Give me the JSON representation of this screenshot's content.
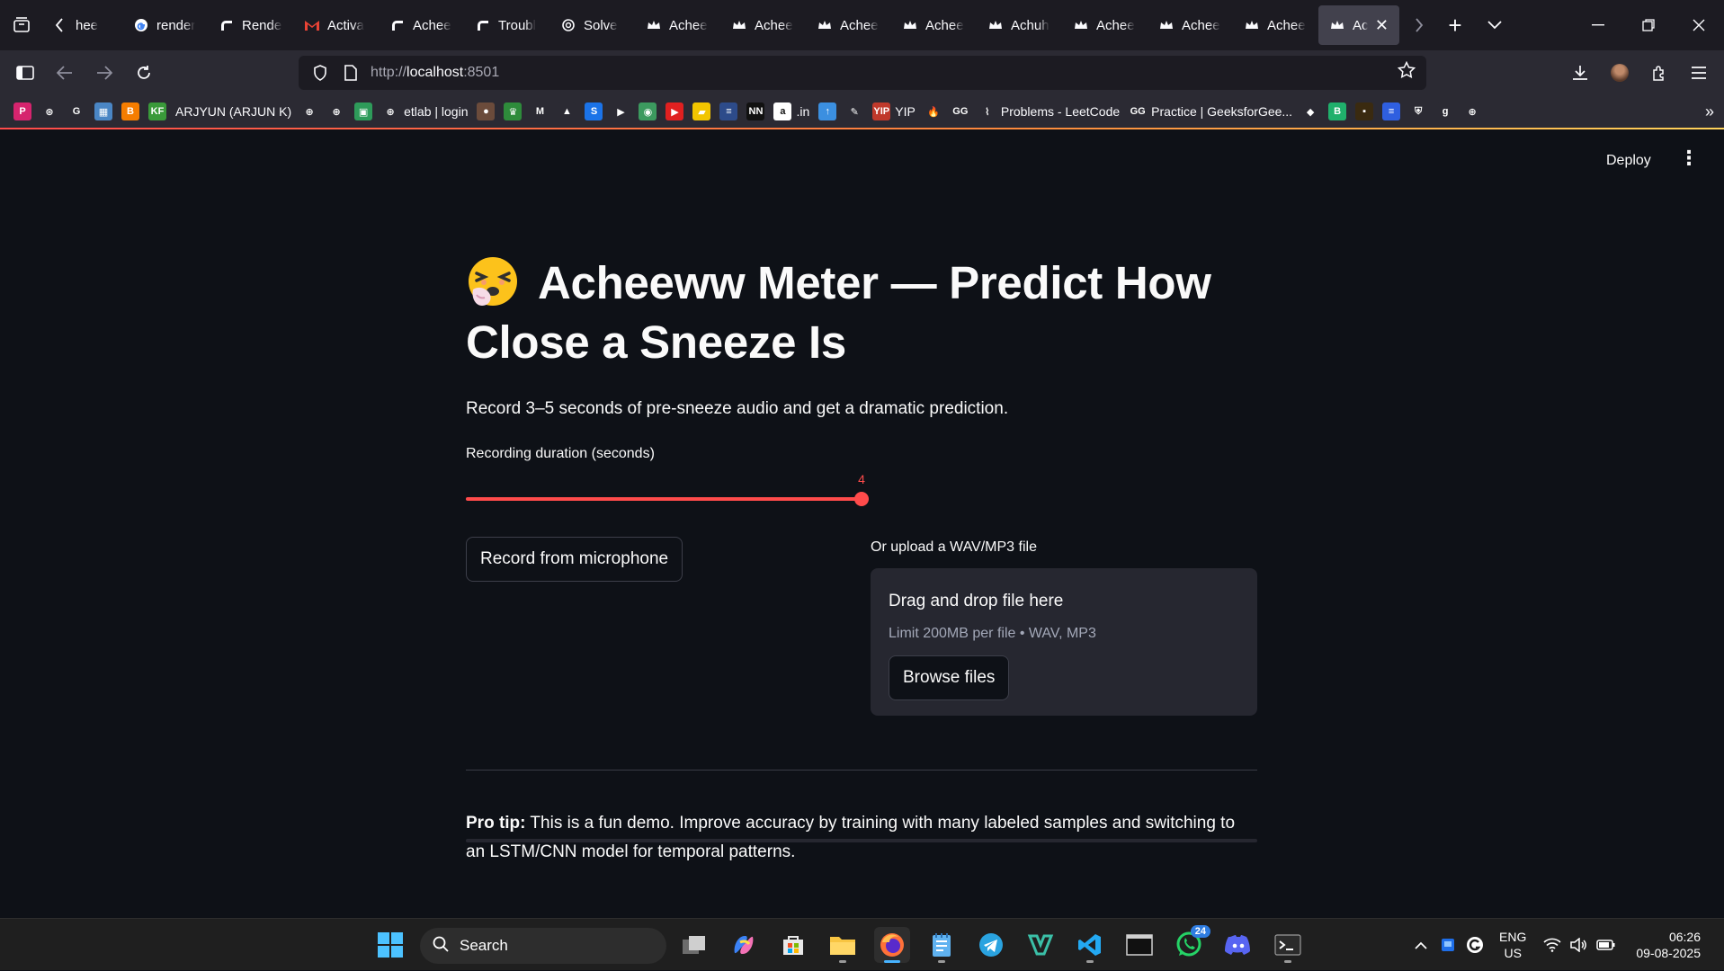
{
  "browser": {
    "tabs": [
      {
        "title": "hee",
        "icon": "crown-icon"
      },
      {
        "title": "render",
        "icon": "google-icon"
      },
      {
        "title": "Render",
        "icon": "render-icon"
      },
      {
        "title": "Activa",
        "icon": "gmail-icon"
      },
      {
        "title": "Achee",
        "icon": "render-icon"
      },
      {
        "title": "Troubl",
        "icon": "render-icon"
      },
      {
        "title": "Solve",
        "icon": "openai-icon"
      },
      {
        "title": "Achee",
        "icon": "crown-icon"
      },
      {
        "title": "Achee",
        "icon": "crown-icon"
      },
      {
        "title": "Achee",
        "icon": "crown-icon"
      },
      {
        "title": "Achee",
        "icon": "crown-icon"
      },
      {
        "title": "Achuh",
        "icon": "crown-icon"
      },
      {
        "title": "Achee",
        "icon": "crown-icon"
      },
      {
        "title": "Achee",
        "icon": "crown-icon"
      },
      {
        "title": "Achee",
        "icon": "crown-icon"
      }
    ],
    "active_tab": {
      "title": "Ach",
      "icon": "crown-icon"
    },
    "url": {
      "prefix": "http://",
      "host": "localhost",
      "port": ":8501"
    },
    "bookmarks": [
      {
        "label": "",
        "icon": "P",
        "color": "#d6246e"
      },
      {
        "label": "",
        "icon": "⊛",
        "color": "#2b2a33"
      },
      {
        "label": "",
        "icon": "G",
        "color": "#2b2a33"
      },
      {
        "label": "",
        "icon": "▦",
        "color": "#4a86c5"
      },
      {
        "label": "",
        "icon": "B",
        "color": "#f57d00"
      },
      {
        "label": "",
        "icon": "KF",
        "color": "#3a9a3a"
      },
      {
        "label": "ARJYUN (ARJUN K)",
        "icon": "",
        "color": "#2b2a33"
      },
      {
        "label": "",
        "icon": "⊕",
        "color": "#2b2a33"
      },
      {
        "label": "",
        "icon": "⊕",
        "color": "#2b2a33"
      },
      {
        "label": "",
        "icon": "▣",
        "color": "#2e9b5a"
      },
      {
        "label": "etlab | login",
        "icon": "⊕",
        "color": "#2b2a33"
      },
      {
        "label": "",
        "icon": "●",
        "color": "#6b4b3b"
      },
      {
        "label": "",
        "icon": "♛",
        "color": "#2e8b3b"
      },
      {
        "label": "",
        "icon": "M",
        "color": "#2b2a33"
      },
      {
        "label": "",
        "icon": "▲",
        "color": "#2b2a33"
      },
      {
        "label": "",
        "icon": "S",
        "color": "#1b73e8"
      },
      {
        "label": "",
        "icon": "▶",
        "color": "#2b2a33"
      },
      {
        "label": "",
        "icon": "◉",
        "color": "#3c9a5f"
      },
      {
        "label": "",
        "icon": "▶",
        "color": "#e02020"
      },
      {
        "label": "",
        "icon": "▰",
        "color": "#f2c500"
      },
      {
        "label": "",
        "icon": "≡",
        "color": "#2d4b8a"
      },
      {
        "label": "",
        "icon": "NN",
        "color": "#111111"
      },
      {
        "label": ".in",
        "icon": "a",
        "color": "#ffffff"
      },
      {
        "label": "",
        "icon": "↑",
        "color": "#3b8fe0"
      },
      {
        "label": "",
        "icon": "✎",
        "color": "#2b2a33"
      },
      {
        "label": "YIP",
        "icon": "YIP",
        "color": "#c0392b"
      },
      {
        "label": "",
        "icon": "🔥",
        "color": "#2b2a33"
      },
      {
        "label": "",
        "icon": "GG",
        "color": "#2b2a33"
      },
      {
        "label": "Problems - LeetCode",
        "icon": "⌇",
        "color": "#2b2a33"
      },
      {
        "label": "Practice | GeeksforGee...",
        "icon": "GG",
        "color": "#2b2a33"
      },
      {
        "label": "",
        "icon": "◆",
        "color": "#2b2a33"
      },
      {
        "label": "",
        "icon": "B",
        "color": "#20b06c"
      },
      {
        "label": "",
        "icon": "▪",
        "color": "#3a2a10"
      },
      {
        "label": "",
        "icon": "≡",
        "color": "#2f5fe0"
      },
      {
        "label": "",
        "icon": "⛨",
        "color": "#2b2a33"
      },
      {
        "label": "",
        "icon": "g",
        "color": "#2b2a33"
      },
      {
        "label": "",
        "icon": "⊕",
        "color": "#2b2a33"
      }
    ]
  },
  "app": {
    "deploy_label": "Deploy",
    "menu_icon": "kebab-menu-icon",
    "title_emoji": "sneezing-face-icon",
    "title": "Acheeww Meter — Predict How Close a Sneeze Is",
    "subtitle": "Record 3–5 seconds of pre-sneeze audio and get a dramatic prediction.",
    "slider": {
      "label": "Recording duration (seconds)",
      "min": 3,
      "max": 5,
      "value": 4,
      "value_text": "4",
      "fraction": 0.5
    },
    "record_button": "Record from microphone",
    "upload": {
      "label": "Or upload a WAV/MP3 file",
      "drop_title": "Drag and drop file here",
      "limit_text": "Limit 200MB per file • WAV, MP3",
      "browse_button": "Browse files"
    },
    "protip": {
      "bold": "Pro tip:",
      "text": " This is a fun demo. Improve accuracy by training with many labeled samples and switching to an LSTM/CNN model for temporal patterns."
    }
  },
  "taskbar": {
    "search_placeholder": "Search",
    "whatsapp_badge": "24",
    "language": "ENG",
    "region": "US",
    "time": "06:26",
    "date": "09-08-2025"
  },
  "colors": {
    "accent": "#ff4b4b",
    "background": "#0e1117",
    "secondary_bg": "#262730"
  }
}
